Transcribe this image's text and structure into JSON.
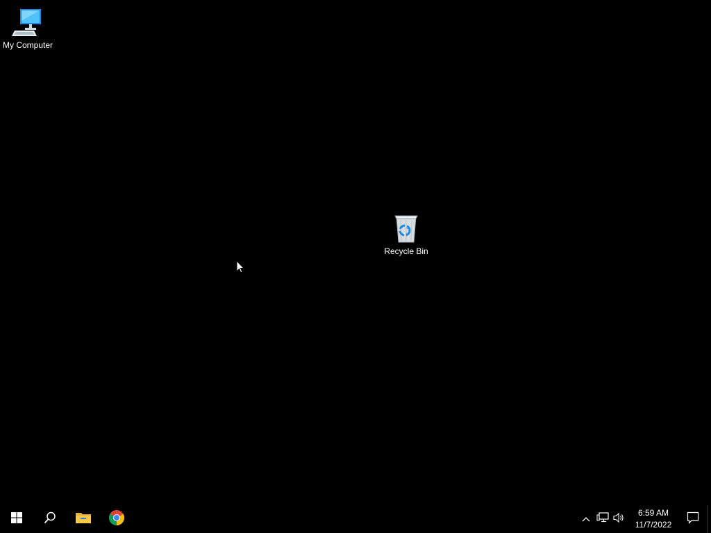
{
  "desktop": {
    "icons": [
      {
        "label": "My Computer",
        "icon": "computer-icon"
      },
      {
        "label": "Recycle Bin",
        "icon": "recycle-bin-icon"
      }
    ]
  },
  "taskbar": {
    "items": [
      {
        "name": "start",
        "icon": "windows-logo-icon"
      },
      {
        "name": "search",
        "icon": "search-icon"
      },
      {
        "name": "file-explorer",
        "icon": "folder-icon"
      },
      {
        "name": "chrome",
        "icon": "chrome-icon"
      }
    ],
    "tray": {
      "icons": [
        "chevron-up-icon",
        "network-icon",
        "volume-icon"
      ],
      "time": "6:59 AM",
      "date": "11/7/2022",
      "notification_icon": "notification-icon"
    }
  },
  "colors": {
    "background": "#000000",
    "taskbar": "#000000",
    "text": "#ffffff",
    "accent": "#2b8cf5"
  }
}
